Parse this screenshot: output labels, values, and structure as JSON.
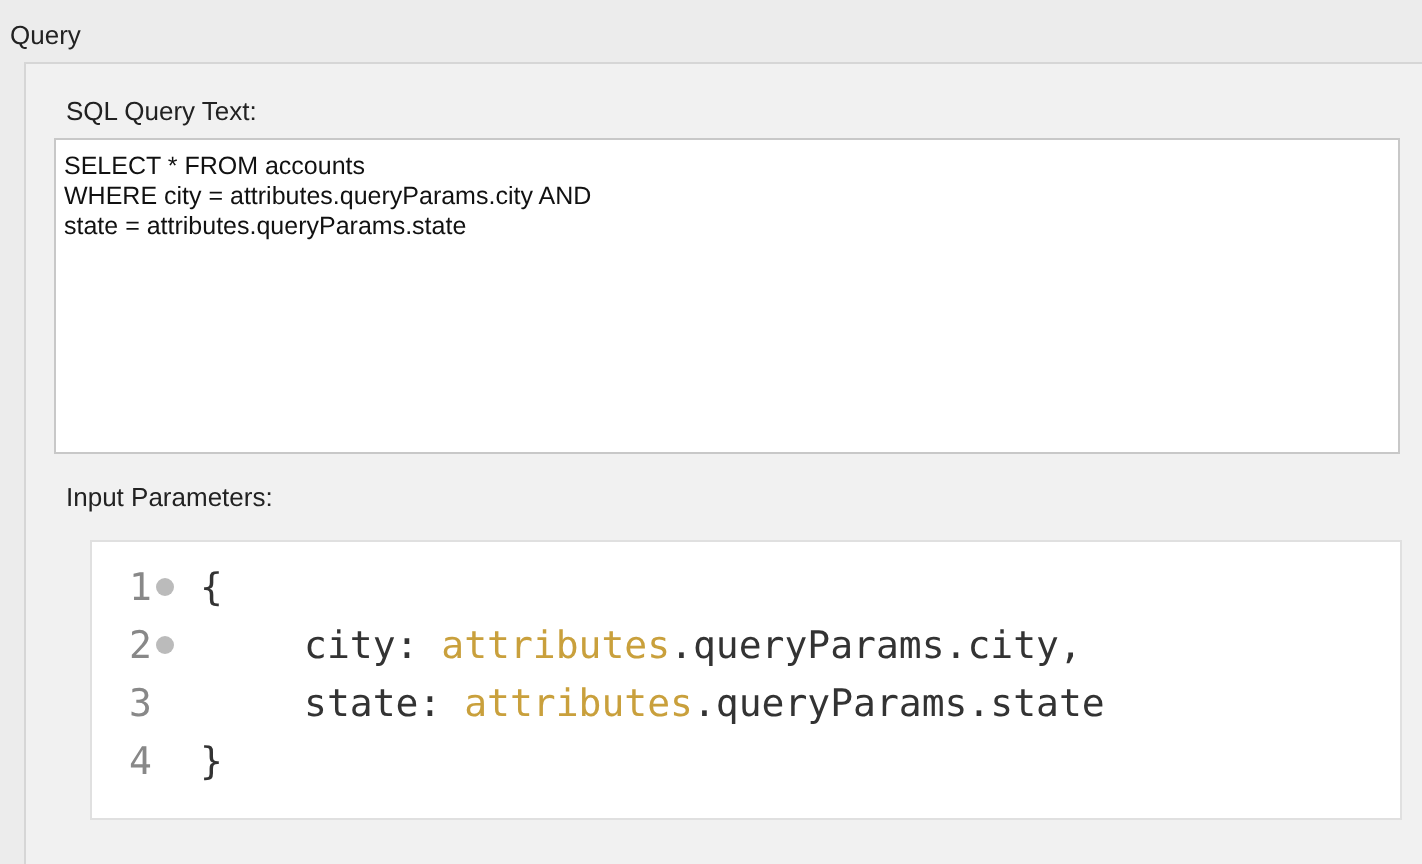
{
  "section_title": "Query",
  "sql_label": "SQL Query Text:",
  "sql_text": "SELECT * FROM accounts\nWHERE city = attributes.queryParams.city AND\nstate = attributes.queryParams.state",
  "params_label": "Input Parameters:",
  "code_lines": [
    {
      "number": "1",
      "foldable": true,
      "tokens": [
        {
          "kind": "plain",
          "text": "{"
        }
      ],
      "children": [
        {
          "number": "2",
          "foldable": true,
          "tokens": [
            {
              "kind": "plain",
              "text": "city: "
            },
            {
              "kind": "object",
              "text": "attributes"
            },
            {
              "kind": "plain",
              "text": ".queryParams.city,"
            }
          ]
        },
        {
          "number": "3",
          "foldable": false,
          "tokens": [
            {
              "kind": "plain",
              "text": "state: "
            },
            {
              "kind": "object",
              "text": "attributes"
            },
            {
              "kind": "plain",
              "text": ".queryParams.state"
            }
          ]
        }
      ]
    },
    {
      "number": "4",
      "foldable": false,
      "tokens": [
        {
          "kind": "plain",
          "text": "}"
        }
      ]
    }
  ]
}
